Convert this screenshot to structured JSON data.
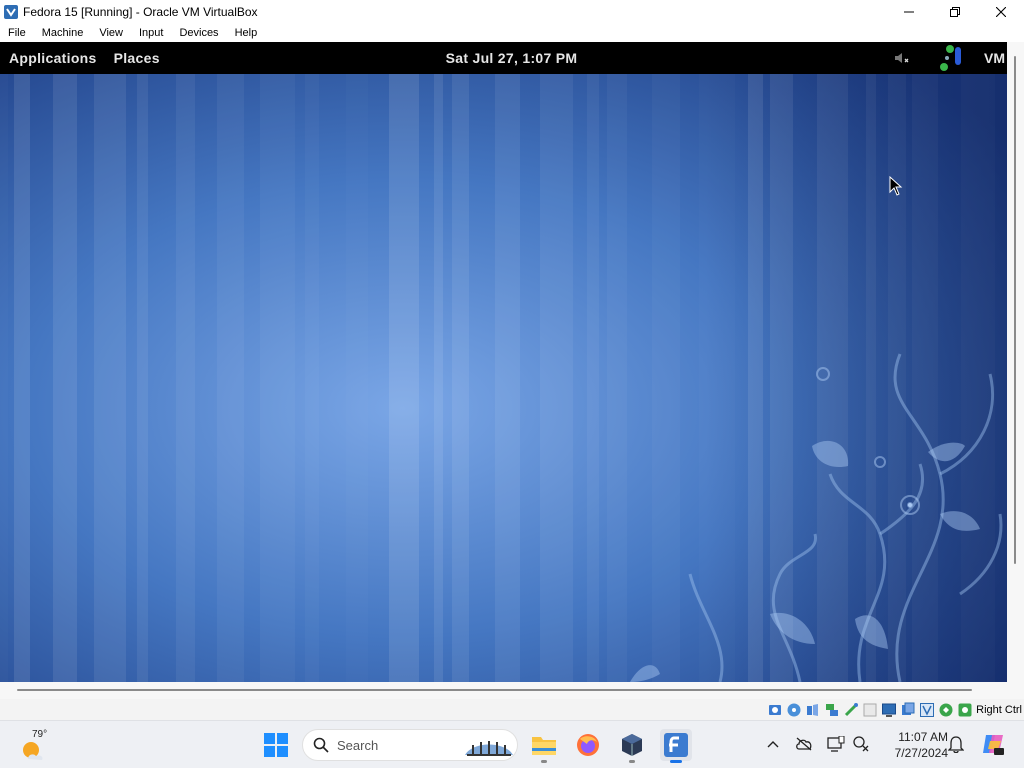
{
  "window": {
    "title": "Fedora 15 [Running] - Oracle VM VirtualBox",
    "menu": [
      "File",
      "Machine",
      "View",
      "Input",
      "Devices",
      "Help"
    ]
  },
  "guest": {
    "panel": {
      "applications": "Applications",
      "places": "Places",
      "clock": "Sat Jul 27,  1:07 PM",
      "user": "VM"
    }
  },
  "statusbar": {
    "host_key": "Right Ctrl",
    "icons": [
      "hard-disk-icon",
      "optical-drive-icon",
      "audio-icon",
      "network-icon",
      "usb-icon",
      "shared-folder-icon",
      "display-icon",
      "recording-icon",
      "vt-x-icon",
      "mouse-integration-icon",
      "keyboard-capture-icon"
    ]
  },
  "taskbar": {
    "weather_temp": "79°",
    "search_placeholder": "Search",
    "time": "11:07 AM",
    "date": "7/27/2024"
  },
  "colors": {
    "panel": "#000000",
    "wallpaper_base": "#3a6cb8",
    "accent": "#1a73e8"
  }
}
